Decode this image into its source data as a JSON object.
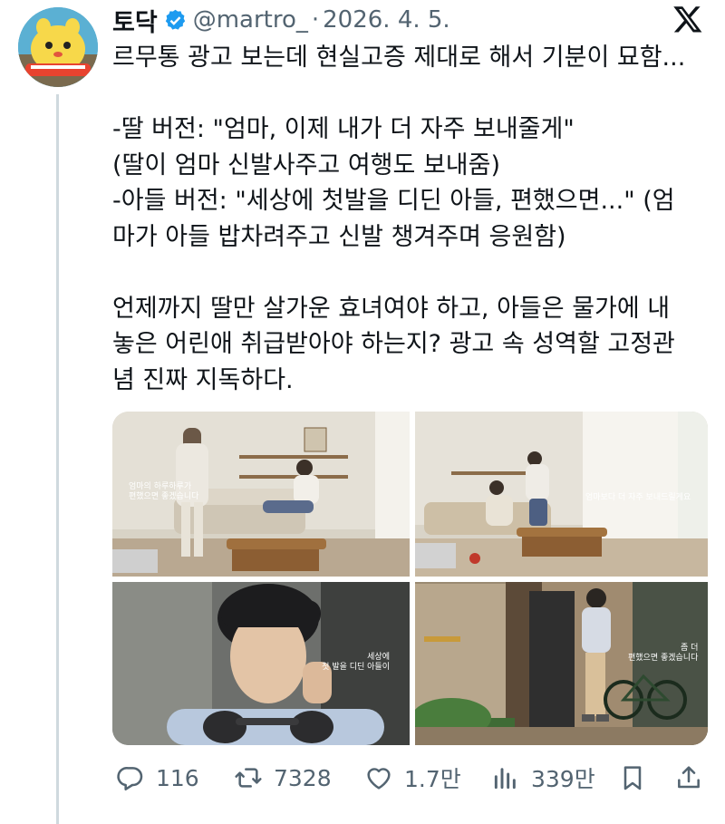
{
  "author": {
    "display_name": "토닥",
    "handle": "@martro_",
    "separator": "·",
    "date": "2026. 4. 5."
  },
  "tweet": {
    "paragraphs": [
      [
        "르무통 광고 보는데 현실고증 제대로 해서 기분이 묘함..."
      ],
      [
        "-딸 버전: \"엄마, 이제 내가 더 자주 보내줄게\"",
        "(딸이 엄마 신발사주고 여행도 보내줌)",
        "-아들 버전: \"세상에 첫발을 디딘 아들, 편했으면...\" (엄",
        "마가 아들 밥차려주고 신발 챙겨주며 응원함)"
      ],
      [
        "언제까지 딸만 살가운 효녀여야 하고, 아들은 물가에 내",
        "놓은 어린애 취급받아야 하는지? 광고 속 성역할 고정관",
        "념 진짜 지독하다."
      ]
    ]
  },
  "media": {
    "captions": [
      [
        "엄마의 하루하루가",
        "편했으면 좋겠습니다"
      ],
      [
        "엄마보다 더 자주 보내드릴게요"
      ],
      [
        "세상에",
        "첫 발을 디딘 아들이"
      ],
      [
        "좀 더",
        "편했으면 좋겠습니다"
      ]
    ]
  },
  "actions": {
    "replies": "116",
    "reposts": "7328",
    "likes": "1.7만",
    "views": "339만"
  },
  "icons": [
    "verified-badge-icon",
    "x-logo-icon",
    "reply-icon",
    "repost-icon",
    "like-icon",
    "views-icon",
    "bookmark-icon",
    "share-icon"
  ],
  "colors": {
    "text": "#0f1419",
    "secondary": "#536471",
    "verified": "#1d9bf0",
    "line": "#cfd9de"
  }
}
